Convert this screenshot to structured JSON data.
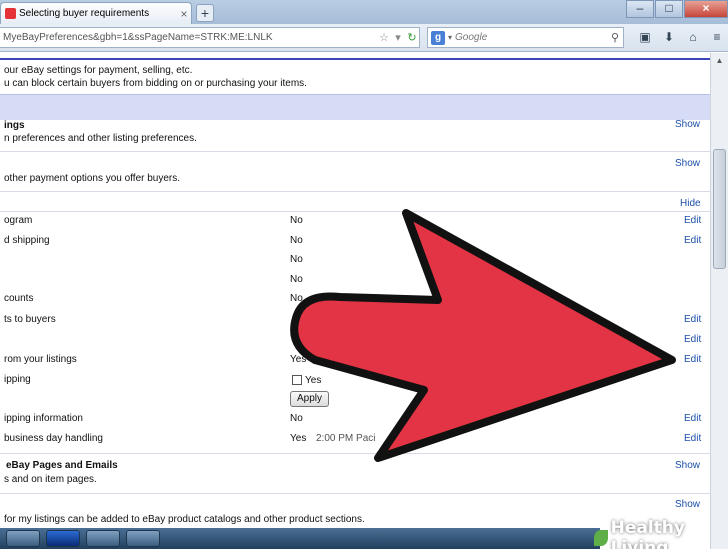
{
  "browser": {
    "tab_title": "Selecting buyer requirements",
    "tab_close": "×",
    "new_tab": "+",
    "url": "MyeBayPreferences&gbh=1&ssPageName=STRK:ME:LNLK",
    "search_placeholder": "Google",
    "search_logo": "g",
    "window_buttons": [
      "–",
      "□",
      "×"
    ],
    "nav_icons": [
      "bookmark-menu-icon",
      "download-icon",
      "home-icon",
      "menu-icon"
    ]
  },
  "page": {
    "intro_line1": "our eBay settings for payment, selling, etc.",
    "intro_line2": "u can block certain buyers from bidding on or purchasing your items.",
    "sections": [
      {
        "title": "ings",
        "desc": "n preferences and other listing preferences.",
        "action": "Show"
      },
      {
        "title": "",
        "desc": "other payment options you offer buyers.",
        "action": "Show"
      }
    ],
    "selling_action": "Hide",
    "rows": [
      {
        "label": "ogram",
        "value": "No",
        "action": "Edit"
      },
      {
        "label": "d shipping",
        "value": "No",
        "action": "Edit"
      },
      {
        "label": "",
        "value": "No",
        "action": ""
      },
      {
        "label": "",
        "value": "No",
        "action": ""
      },
      {
        "label": "counts",
        "value": "No",
        "action": ""
      },
      {
        "label": "ts to buyers",
        "value": "",
        "action": "Edit"
      },
      {
        "label": "",
        "value": "",
        "action": "Edit"
      },
      {
        "label": "rom your listings",
        "value": "Yes",
        "action": "Edit"
      },
      {
        "label": "ipping",
        "value": "",
        "action": ""
      },
      {
        "label": "ipping information",
        "value": "No",
        "action": "Edit"
      },
      {
        "label": "business day handling",
        "value": "Yes",
        "action": "Edit"
      }
    ],
    "checkbox_label": "Yes",
    "apply_label": "Apply",
    "handling_time": "2:00 PM Paci",
    "pages_emails": {
      "title": "eBay Pages and Emails",
      "desc": "s and on item pages.",
      "action": "Show"
    },
    "catalog": {
      "desc": "for my listings can be added to eBay product catalogs and other product sections.",
      "action": "Show"
    }
  },
  "colors": {
    "arrow": "#e23444",
    "bar": "#d6dcf6",
    "link": "#1b4fa8"
  },
  "watermark": "Healthy Living"
}
